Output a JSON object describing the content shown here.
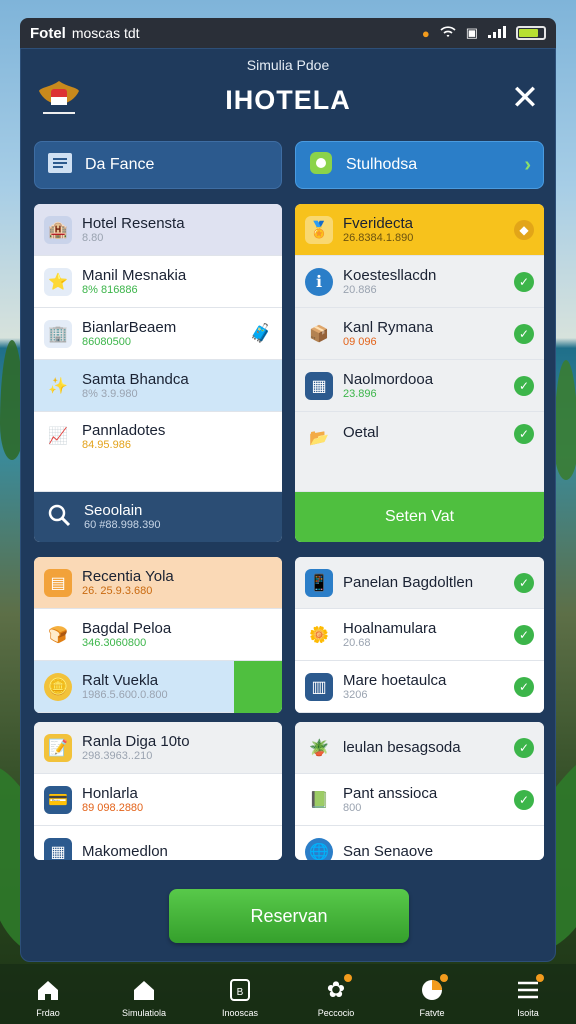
{
  "statusbar": {
    "brand": "Fotel",
    "carrier": "moscas tdt",
    "colors": {
      "battery": "#b7e032"
    }
  },
  "header": {
    "subtitle": "Simulia Pdoe",
    "title": "IHOTELA",
    "close_icon": "close-icon"
  },
  "top_buttons": {
    "left": "Da Fance",
    "right": "Stulhodsa"
  },
  "left_card1": {
    "rows": [
      {
        "name": "Hotel Resensta",
        "value": "8.80"
      },
      {
        "name": "Manil Mesnakia",
        "value": "8% 816886"
      },
      {
        "name": "BianlarBeaem",
        "value": "86080500"
      },
      {
        "name": "Samta Bhandca",
        "value": "8% 3.9.980"
      },
      {
        "name": "Pannladotes",
        "value": "84.95.986"
      }
    ],
    "search": {
      "name": "Seoolain",
      "value": "60 #88.998.390"
    }
  },
  "right_card1": {
    "rows": [
      {
        "name": "Fveridecta",
        "value": "26.8384.1.890"
      },
      {
        "name": "Koestesllacdn",
        "value": "20.886"
      },
      {
        "name": "Kanl Rymana",
        "value": "09 096"
      },
      {
        "name": "Naolmordooa",
        "value": "23.896"
      },
      {
        "name": "Oetal",
        "value": ""
      }
    ],
    "button": "Seten Vat"
  },
  "left_card2": {
    "rows": [
      {
        "name": "Recentia Yola",
        "value": "26. 25.9.3.680"
      },
      {
        "name": "Bagdal Peloa",
        "value": "346.3060800"
      },
      {
        "name": "Ralt Vuekla",
        "value": "1986.5.600.0.800"
      }
    ]
  },
  "right_card2": {
    "rows": [
      {
        "name": "Panelan Bagdoltlen",
        "value": ""
      },
      {
        "name": "Hoalnamulara",
        "value": "20.68"
      },
      {
        "name": "Mare hoetaulca",
        "value": "3206"
      }
    ]
  },
  "left_card3": {
    "rows": [
      {
        "name": "Ranla Diga 10to",
        "value": "298.3963..210"
      },
      {
        "name": "Honlarla",
        "value": "89 098.2880"
      },
      {
        "name": "Makomedlon",
        "value": ""
      }
    ]
  },
  "right_card3": {
    "rows": [
      {
        "name": "leulan besagsoda",
        "value": ""
      },
      {
        "name": "Pant anssioca",
        "value": "800"
      },
      {
        "name": "San Senaove",
        "value": ""
      }
    ]
  },
  "reserve_button": "Reservan",
  "tabs": [
    {
      "label": "Frdao",
      "icon": "home-icon"
    },
    {
      "label": "Simulatiola",
      "icon": "house-icon"
    },
    {
      "label": "Inooscas",
      "icon": "booking-icon"
    },
    {
      "label": "Peccocio",
      "icon": "gift-icon"
    },
    {
      "label": "Fatvte",
      "icon": "pie-icon"
    },
    {
      "label": "Isoita",
      "icon": "menu-icon"
    }
  ],
  "colors": {
    "panel": "#1f3a5c",
    "accent_green": "#4fbf3f",
    "accent_blue": "#2b7ec8",
    "header_yellow": "#f7c21c"
  }
}
